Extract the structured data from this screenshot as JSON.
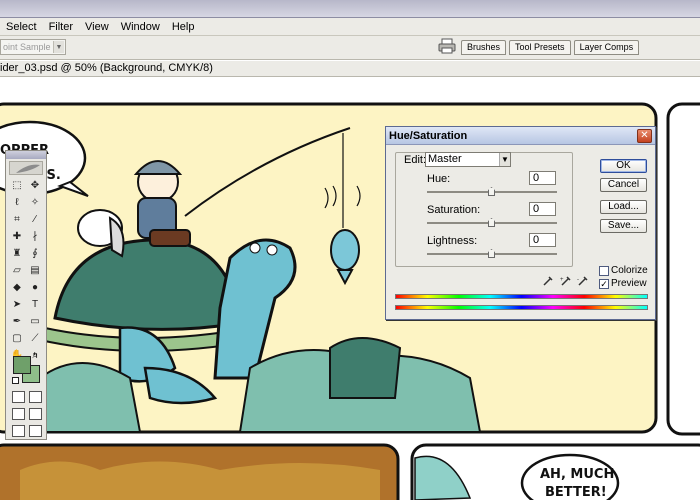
{
  "menu": {
    "items": [
      "Select",
      "Filter",
      "View",
      "Window",
      "Help"
    ]
  },
  "options_bar": {
    "sample_value": "oint Sample"
  },
  "palette_well": {
    "tabs": [
      "Brushes",
      "Tool Presets",
      "Layer Comps"
    ]
  },
  "document": {
    "title": "ider_03.psd @ 50% (Background, CMYK/8)"
  },
  "comic": {
    "bubble_top_left": [
      "OPPER",
      "US."
    ],
    "bubble_bottom_right": [
      "AH, MUCH",
      "BETTER!"
    ]
  },
  "toolbox": {
    "swatch_fg": "#6fa06a",
    "swatch_bg": "#8fbf8a"
  },
  "dialog": {
    "title": "Hue/Saturation",
    "edit_label": "Edit:",
    "edit_value": "Master",
    "hue_label": "Hue:",
    "hue_value": "0",
    "saturation_label": "Saturation:",
    "saturation_value": "0",
    "lightness_label": "Lightness:",
    "lightness_value": "0",
    "buttons": {
      "ok": "OK",
      "cancel": "Cancel",
      "load": "Load...",
      "save": "Save..."
    },
    "colorize_label": "Colorize",
    "colorize_checked": false,
    "preview_label": "Preview",
    "preview_checked": true,
    "preview_mark": "✓"
  }
}
